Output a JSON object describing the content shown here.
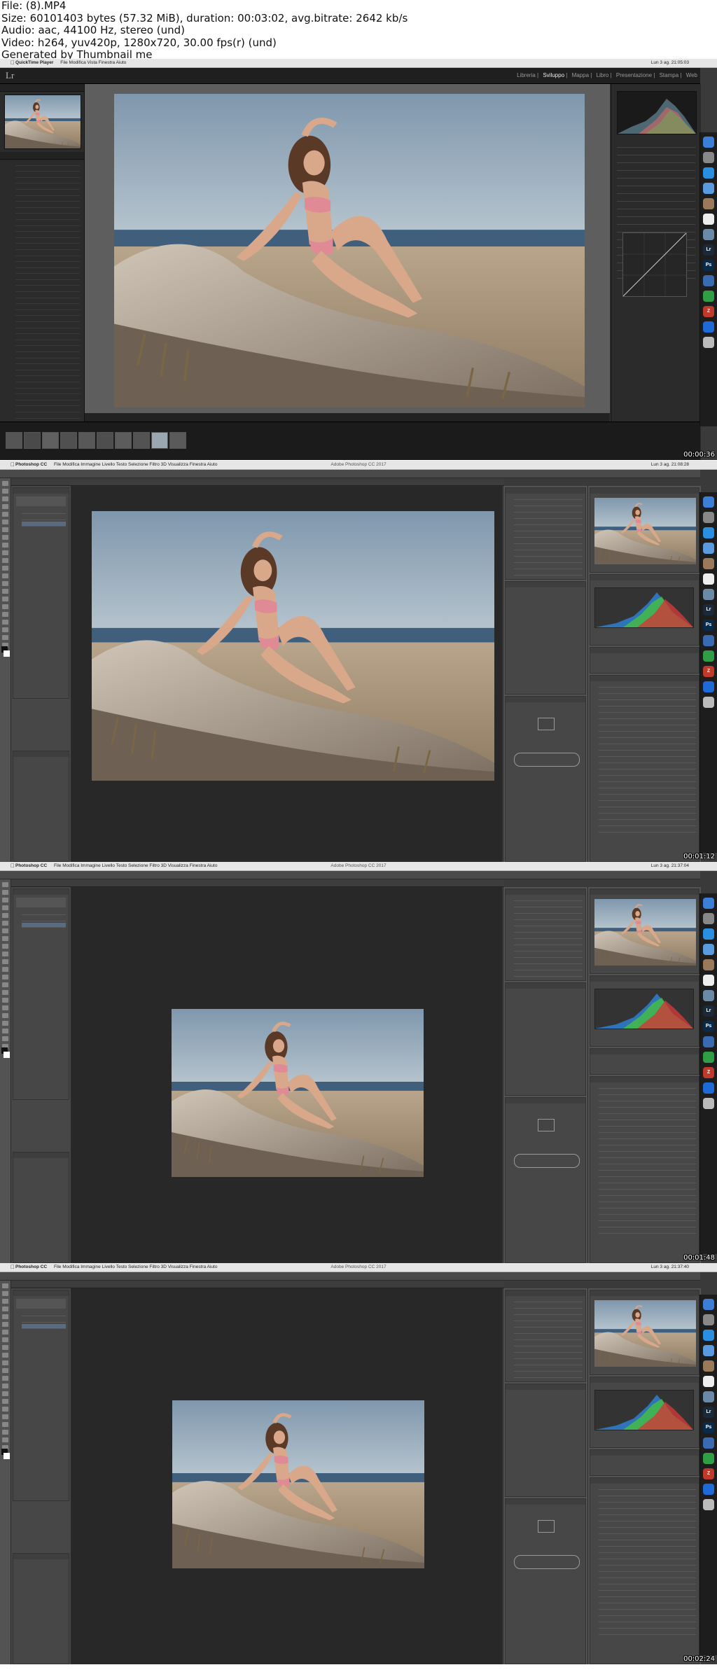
{
  "header_lines": [
    "File:  (8).MP4",
    "Size: 60101403 bytes (57.32 MiB), duration: 00:03:02, avg.bitrate: 2642 kb/s",
    "Audio: aac, 44100 Hz, stereo (und)",
    "Video: h264, yuv420p, 1280x720, 30.00 fps(r) (und)",
    "Generated by Thumbnail me"
  ],
  "frames": [
    {
      "app": "QuickTime Player",
      "menu": [
        "File",
        "Modifica",
        "Vista",
        "Finestra",
        "Aiuto"
      ],
      "title": "",
      "clock": "Lun 3 ag. 21:05:03",
      "timestamp": "00:00:36",
      "modules": [
        "Libreria",
        "Sviluppo",
        "Mappa",
        "Libro",
        "Presentazione",
        "Stampa",
        "Web"
      ],
      "active_module": "Sviluppo",
      "logo": "Lr"
    },
    {
      "app": "Photoshop CC",
      "menu": [
        "File",
        "Modifica",
        "Immagine",
        "Livello",
        "Testo",
        "Selezione",
        "Filtro",
        "3D",
        "Visualizza",
        "Finestra",
        "Aiuto"
      ],
      "title": "Adobe Photoshop CC 2017",
      "clock": "Lun 3 ag. 21:08:28",
      "timestamp": "00:01:12"
    },
    {
      "app": "Photoshop CC",
      "menu": [
        "File",
        "Modifica",
        "Immagine",
        "Livello",
        "Testo",
        "Selezione",
        "Filtro",
        "3D",
        "Visualizza",
        "Finestra",
        "Aiuto"
      ],
      "title": "Adobe Photoshop CC 2017",
      "clock": "Lun 3 ag. 21:37:04",
      "timestamp": "00:01:48"
    },
    {
      "app": "Photoshop CC",
      "menu": [
        "File",
        "Modifica",
        "Immagine",
        "Livello",
        "Testo",
        "Selezione",
        "Filtro",
        "3D",
        "Visualizza",
        "Finestra",
        "Aiuto"
      ],
      "title": "Adobe Photoshop CC 2017",
      "clock": "Lun 3 ag. 21:37:40",
      "timestamp": "00:02:24"
    }
  ],
  "dock_icons": [
    {
      "icon": "finder-icon",
      "color": "#3d7fd6",
      "glyph": ""
    },
    {
      "icon": "launchpad-icon",
      "color": "#888888",
      "glyph": ""
    },
    {
      "icon": "safari-icon",
      "color": "#2a8fe0",
      "glyph": ""
    },
    {
      "icon": "mail-icon",
      "color": "#5a9be0",
      "glyph": ""
    },
    {
      "icon": "contacts-icon",
      "color": "#9a7a5a",
      "glyph": ""
    },
    {
      "icon": "calendar-icon",
      "color": "#eeeeee",
      "glyph": ""
    },
    {
      "icon": "preview-icon",
      "color": "#6a8aa8",
      "glyph": ""
    },
    {
      "icon": "lightroom-icon",
      "color": "#1b2a3a",
      "glyph": "Lr"
    },
    {
      "icon": "photoshop-icon",
      "color": "#0a2a4a",
      "glyph": "Ps"
    },
    {
      "icon": "app-icon",
      "color": "#3a6ab0",
      "glyph": ""
    },
    {
      "icon": "chrome-icon",
      "color": "#2f9e44",
      "glyph": ""
    },
    {
      "icon": "filezilla-icon",
      "color": "#c0392b",
      "glyph": "Z"
    },
    {
      "icon": "teamviewer-icon",
      "color": "#1e6ad6",
      "glyph": ""
    },
    {
      "icon": "trash-icon",
      "color": "#bbbbbb",
      "glyph": ""
    }
  ]
}
